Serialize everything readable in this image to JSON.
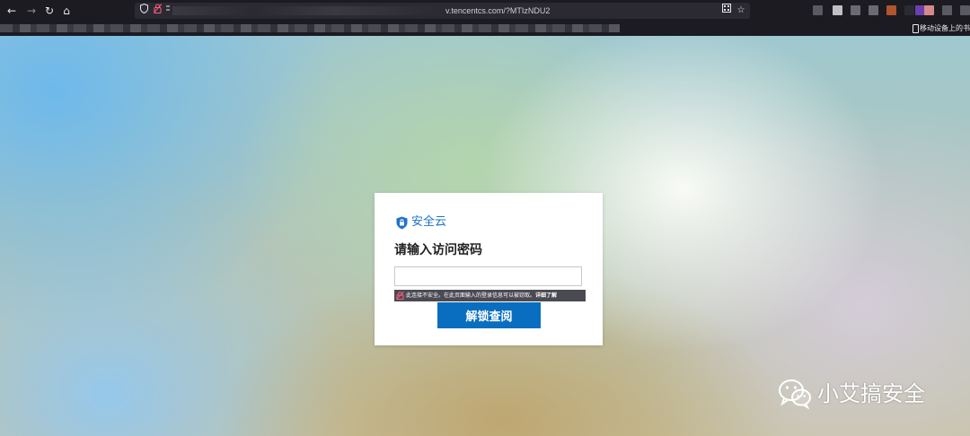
{
  "browser": {
    "url_text": "v.tencentcs.com/?MTIzNDU2",
    "mobile_bookmarks_label": "移动设备上的书签",
    "nav_icons": [
      "back-icon",
      "forward-icon",
      "reload-icon",
      "home-icon"
    ],
    "extension_colors": [
      "#5a5a63",
      "#bfbfc4",
      "#6a6a72",
      "#6a6a72",
      "#b2542e",
      "#2a2a33",
      "#6a3fb0",
      "#d48a8a",
      "#5a5a63",
      "#5a5a63"
    ]
  },
  "card": {
    "brand_name": "安全云",
    "heading": "请输入访问密码",
    "password_value": "",
    "insecure_warning": "此连接不安全。在此页面输入的登录信息可以被窃取。",
    "learn_more": "详细了解",
    "unlock_button": "解锁查阅"
  },
  "watermark": {
    "text": "小艾搞安全"
  },
  "colors": {
    "brand_blue": "#1d73c9",
    "button_blue": "#0a6ec0",
    "chrome_dark": "#1c1b22"
  }
}
